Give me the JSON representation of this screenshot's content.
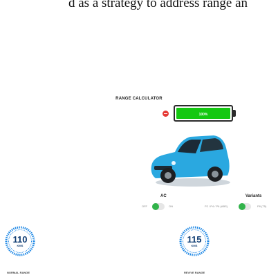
{
  "caption": {
    "text": "d as a strategy to address range an"
  },
  "calculator": {
    "title": "RANGE CALCULATOR",
    "battery_label": "100%",
    "battery_level": 1.0,
    "battery_color": "#14c811",
    "decrease_color": "#e53935"
  },
  "ac": {
    "title": "AC",
    "off_label": "OFF",
    "on_label": "ON",
    "state": "off"
  },
  "variants": {
    "title": "Variants",
    "left_label": "P2 / P4 / P6 (ABS)",
    "right_label": "P8 (T5)",
    "state": "left"
  },
  "ranges": {
    "normal": {
      "value": "110",
      "unit": "KMS",
      "label": "NORMAL RANGE"
    },
    "revive": {
      "value": "115",
      "unit": "KMS",
      "label": "REVIVE RANGE"
    }
  },
  "colors": {
    "gauge": "#1e88e5",
    "gauge_text": "#0d3b72",
    "toggle_on": "#31b34a",
    "car_body": "#2aa8e0"
  }
}
